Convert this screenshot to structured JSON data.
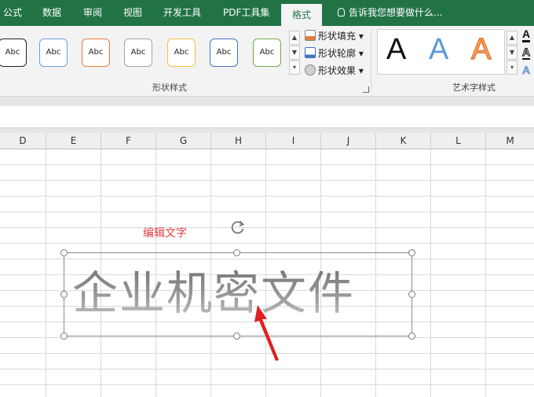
{
  "tabs": [
    "公式",
    "数据",
    "审阅",
    "视图",
    "开发工具",
    "PDF工具集",
    "格式"
  ],
  "active_tab": "格式",
  "tell_me": "告诉我您想要做什么...",
  "shape_styles": {
    "swatches": [
      {
        "label": "Abc",
        "color": "#222222"
      },
      {
        "label": "Abc",
        "color": "#6f9fd8"
      },
      {
        "label": "Abc",
        "color": "#e57b3a"
      },
      {
        "label": "Abc",
        "color": "#a5a5a5"
      },
      {
        "label": "Abc",
        "color": "#f4c242"
      },
      {
        "label": "Abc",
        "color": "#4472c4"
      },
      {
        "label": "Abc",
        "color": "#70ad47"
      }
    ],
    "commands": [
      "形状填充",
      "形状轮廓",
      "形状效果"
    ],
    "group_label": "形状样式"
  },
  "wordart_styles": {
    "letters": [
      {
        "text": "A",
        "color": "#111111"
      },
      {
        "text": "A",
        "color": "#5b9bd5"
      },
      {
        "text": "A",
        "color": "#f4a460"
      }
    ],
    "side_letters": [
      "A",
      "A",
      "A"
    ],
    "group_label": "艺术字样式"
  },
  "columns": [
    "D",
    "E",
    "F",
    "G",
    "H",
    "I",
    "J",
    "K",
    "L",
    "M"
  ],
  "wordart_text": "企业机密文件",
  "annotation_text": "编辑文字",
  "colors": {
    "tab_bar": "#217346",
    "annotation": "#e23b3b",
    "arrow": "#e02020"
  }
}
